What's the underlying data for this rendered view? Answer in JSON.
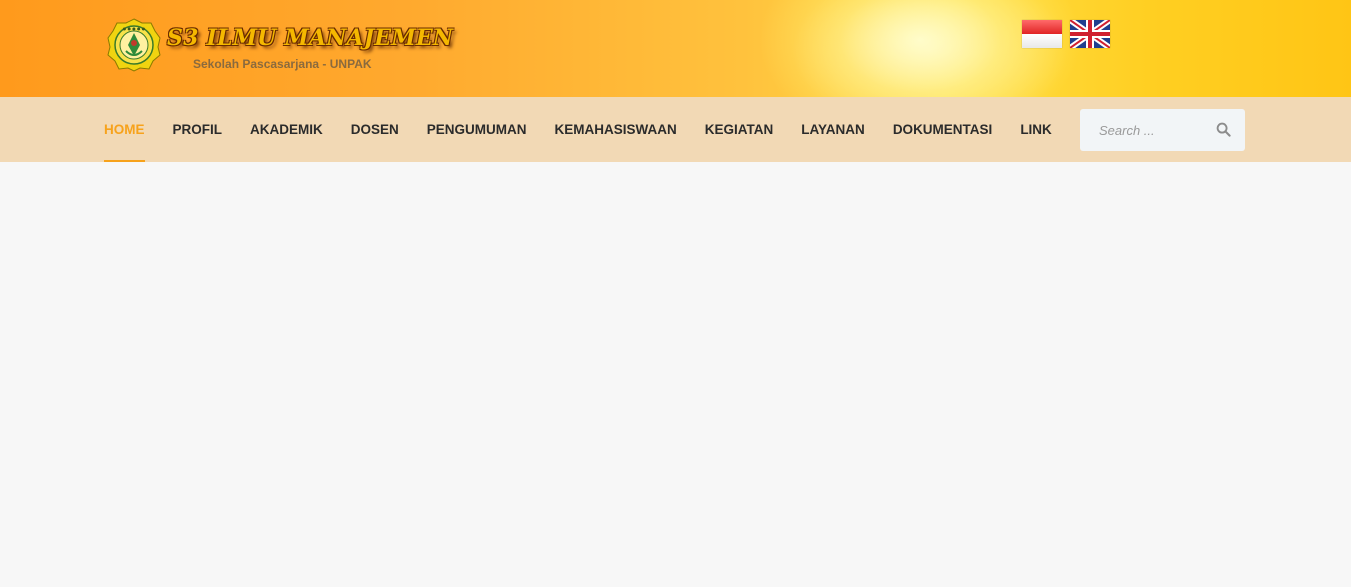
{
  "header": {
    "site_title": "S3 ILMU MANAJEMEN",
    "site_subtitle": "Sekolah Pascasarjana - UNPAK",
    "logo": "university-emblem",
    "languages": [
      {
        "code": "id",
        "icon": "indonesia-flag-icon"
      },
      {
        "code": "en",
        "icon": "uk-flag-icon"
      }
    ]
  },
  "nav": {
    "items": [
      {
        "label": "HOME",
        "active": true
      },
      {
        "label": "PROFIL",
        "active": false
      },
      {
        "label": "AKADEMIK",
        "active": false
      },
      {
        "label": "DOSEN",
        "active": false
      },
      {
        "label": "PENGUMUMAN",
        "active": false
      },
      {
        "label": "KEMAHASISWAAN",
        "active": false
      },
      {
        "label": "KEGIATAN",
        "active": false
      },
      {
        "label": "LAYANAN",
        "active": false
      },
      {
        "label": "DOKUMENTASI",
        "active": false
      },
      {
        "label": "LINK",
        "active": false
      }
    ]
  },
  "search": {
    "placeholder": "Search ...",
    "value": "",
    "icon": "search-icon"
  },
  "colors": {
    "accent": "#f7a21b",
    "nav_background": "#f2d9b5",
    "page_background": "#f7f7f7",
    "header_orange": "#ff9a1c",
    "header_yellow": "#ffdd45"
  }
}
